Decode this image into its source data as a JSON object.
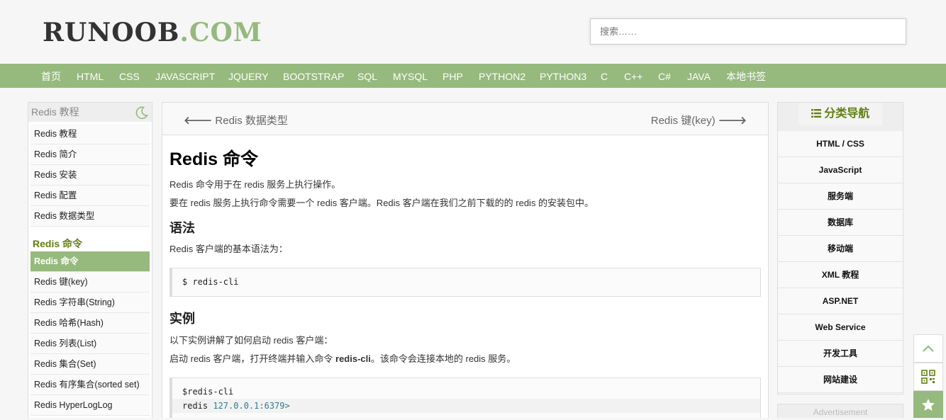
{
  "logo": {
    "part1": "RUNOOB",
    "part2": ".COM"
  },
  "search": {
    "placeholder": "搜索……"
  },
  "nav": [
    "首页",
    "HTML",
    "CSS",
    "JAVASCRIPT",
    "JQUERY",
    "BOOTSTRAP",
    "SQL",
    "MYSQL",
    "PHP",
    "PYTHON2",
    "PYTHON3",
    "C",
    "C++",
    "C#",
    "JAVA",
    "本地书签"
  ],
  "sidebar": {
    "title": "Redis 教程",
    "items": [
      "Redis 教程",
      "Redis 简介",
      "Redis 安装",
      "Redis 配置",
      "Redis 数据类型"
    ],
    "section": "Redis 命令",
    "items2": [
      "Redis 命令",
      "Redis 键(key)",
      "Redis 字符串(String)",
      "Redis 哈希(Hash)",
      "Redis 列表(List)",
      "Redis 集合(Set)",
      "Redis 有序集合(sorted set)",
      "Redis HyperLogLog"
    ]
  },
  "pager": {
    "prev": "Redis 数据类型",
    "next": "Redis 键(key)"
  },
  "article": {
    "title": "Redis 命令",
    "p1": "Redis 命令用于在 redis 服务上执行操作。",
    "p2": "要在 redis 服务上执行命令需要一个 redis 客户端。Redis 客户端在我们之前下载的的 redis 的安装包中。",
    "h_syntax": "语法",
    "p3": "Redis 客户端的基本语法为：",
    "code1": "$ redis-cli",
    "h_example": "实例",
    "p4": "以下实例讲解了如何启动 redis 客户端：",
    "p5_pre": "启动 redis 客户端，打开终端并输入命令 ",
    "p5_bold": "redis-cli",
    "p5_post": "。该命令会连接本地的 redis 服务。",
    "code2_l1": "$redis-cli",
    "code2_l2_a": "redis ",
    "code2_l2_b": "127.0.0.1:6379>"
  },
  "rightnav": {
    "title": "分类导航",
    "items": [
      "HTML / CSS",
      "JavaScript",
      "服务端",
      "数据库",
      "移动端",
      "XML 教程",
      "ASP.NET",
      "Web Service",
      "开发工具",
      "网站建设"
    ]
  },
  "ad": {
    "label": "Advertisement"
  },
  "colors": {
    "accent": "#96b97d",
    "dark_accent": "#617f10"
  }
}
